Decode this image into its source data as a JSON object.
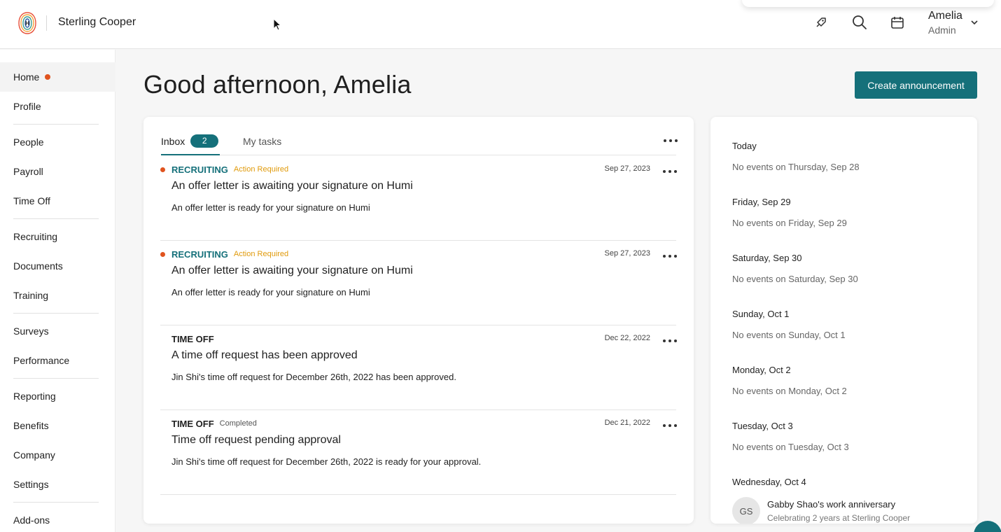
{
  "header": {
    "company": "Sterling Cooper",
    "user_name": "Amelia",
    "user_role": "Admin",
    "icons": [
      "rocket-icon",
      "search-icon",
      "calendar-icon",
      "chevron-down-icon"
    ]
  },
  "sidebar": {
    "items": [
      {
        "label": "Home"
      },
      {
        "label": "Profile"
      },
      {
        "label": "People"
      },
      {
        "label": "Payroll"
      },
      {
        "label": "Time Off"
      },
      {
        "label": "Recruiting"
      },
      {
        "label": "Documents"
      },
      {
        "label": "Training"
      },
      {
        "label": "Surveys"
      },
      {
        "label": "Performance"
      },
      {
        "label": "Reporting"
      },
      {
        "label": "Benefits"
      },
      {
        "label": "Company"
      },
      {
        "label": "Settings"
      },
      {
        "label": "Add-ons"
      }
    ]
  },
  "main": {
    "greeting": "Good afternoon, Amelia",
    "create_button": "Create announcement"
  },
  "inbox": {
    "tab_inbox": "Inbox",
    "inbox_count": "2",
    "tab_tasks": "My tasks",
    "items": [
      {
        "category": "RECRUITING",
        "status": "Action Required",
        "date": "Sep 27, 2023",
        "title": "An offer letter is awaiting your signature on Humi",
        "body": "An offer letter is ready for your signature on Humi"
      },
      {
        "category": "RECRUITING",
        "status": "Action Required",
        "date": "Sep 27, 2023",
        "title": "An offer letter is awaiting your signature on Humi",
        "body": "An offer letter is ready for your signature on Humi"
      },
      {
        "category": "TIME OFF",
        "status": "",
        "date": "Dec 22, 2022",
        "title": "A time off request has been approved",
        "body": "Jin Shi's time off request for December 26th, 2022 has been approved."
      },
      {
        "category": "TIME OFF",
        "status": "Completed",
        "date": "Dec 21, 2022",
        "title": "Time off request pending approval",
        "body": "Jin Shi's time off request for December 26th, 2022 is ready for your approval."
      }
    ]
  },
  "calendar": {
    "days": [
      {
        "day": "Today",
        "note": "No events on Thursday, Sep 28"
      },
      {
        "day": "Friday, Sep 29",
        "note": "No events on Friday, Sep 29"
      },
      {
        "day": "Saturday, Sep 30",
        "note": "No events on Saturday, Sep 30"
      },
      {
        "day": "Sunday, Oct 1",
        "note": "No events on Sunday, Oct 1"
      },
      {
        "day": "Monday, Oct 2",
        "note": "No events on Monday, Oct 2"
      },
      {
        "day": "Tuesday, Oct 3",
        "note": "No events on Tuesday, Oct 3"
      },
      {
        "day": "Wednesday, Oct 4",
        "note": ""
      }
    ],
    "event": {
      "initials": "GS",
      "title": "Gabby Shao's work anniversary",
      "subtitle": "Celebrating 2 years at Sterling Cooper"
    }
  },
  "colors": {
    "accent": "#15707a",
    "unread": "#e0531e",
    "action_required": "#e09a0b"
  }
}
